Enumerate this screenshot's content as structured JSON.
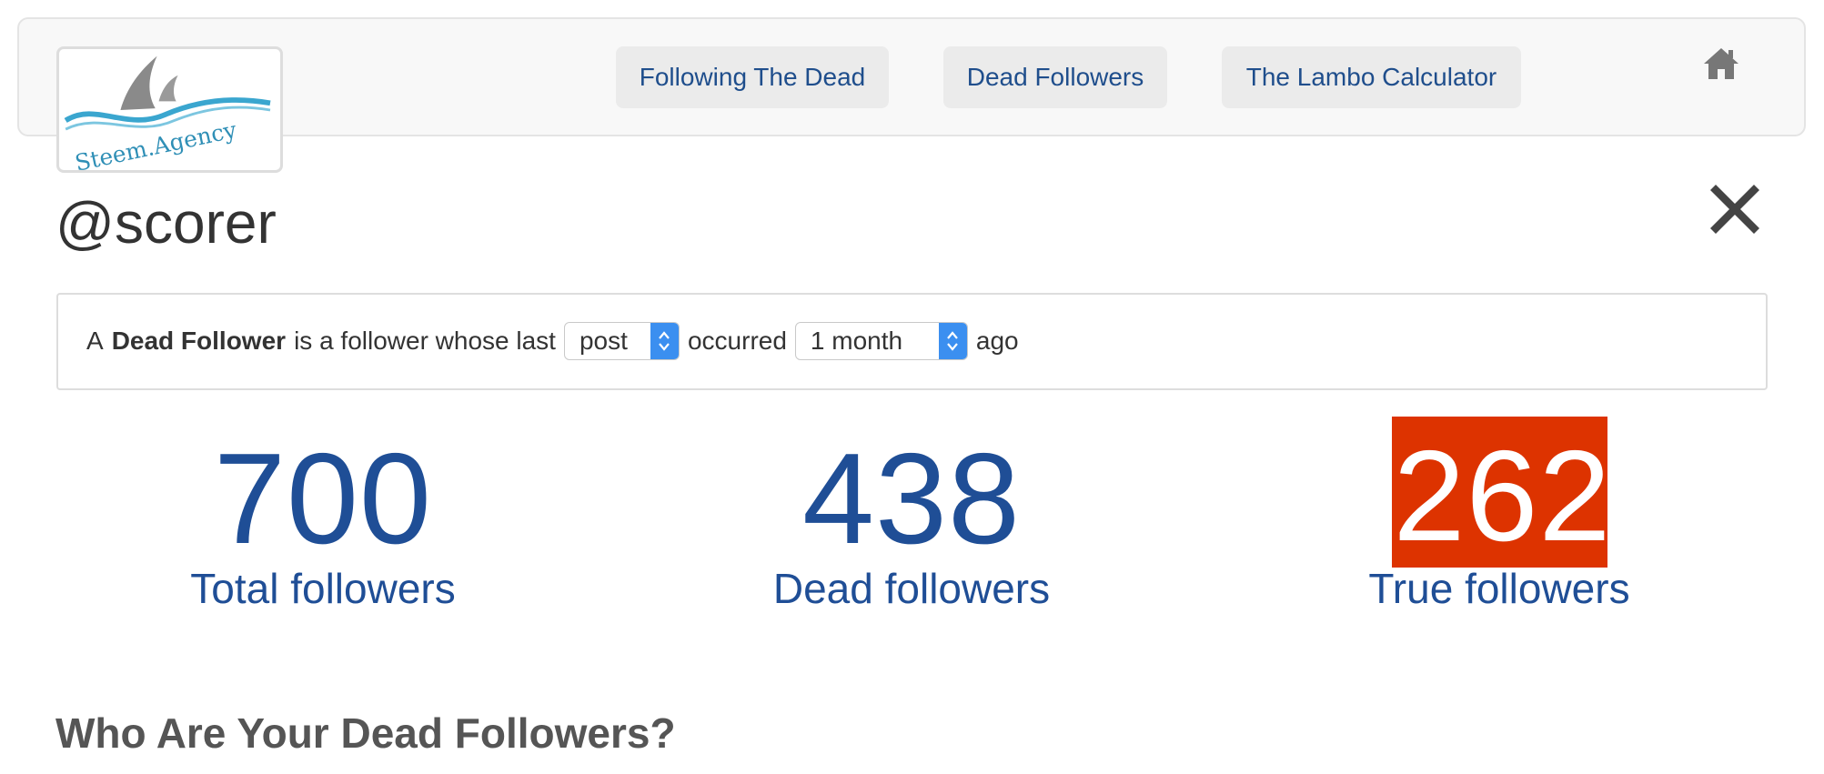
{
  "logo": {
    "text": "Steem.Agency"
  },
  "nav": {
    "items": [
      {
        "label": "Following The Dead"
      },
      {
        "label": "Dead Followers"
      },
      {
        "label": "The Lambo Calculator"
      }
    ],
    "home_icon": "home-icon"
  },
  "profile": {
    "username": "@scorer"
  },
  "close_icon": "close-icon",
  "definition": {
    "prefix": "A",
    "term": "Dead Follower",
    "middle": "is a follower whose last",
    "activity_select": {
      "value": "post"
    },
    "occurred": "occurred",
    "period_select": {
      "value": "1 month"
    },
    "suffix": "ago"
  },
  "stats": [
    {
      "value": "700",
      "label": "Total followers"
    },
    {
      "value": "438",
      "label": "Dead followers"
    },
    {
      "value": "262",
      "label": "True followers",
      "highlight_color": "#dd3300"
    }
  ],
  "section": {
    "title": "Who Are Your Dead Followers?"
  },
  "colors": {
    "accent_blue": "#1f4e96",
    "highlight": "#dd3300",
    "select_blue": "#3b8ff0"
  }
}
